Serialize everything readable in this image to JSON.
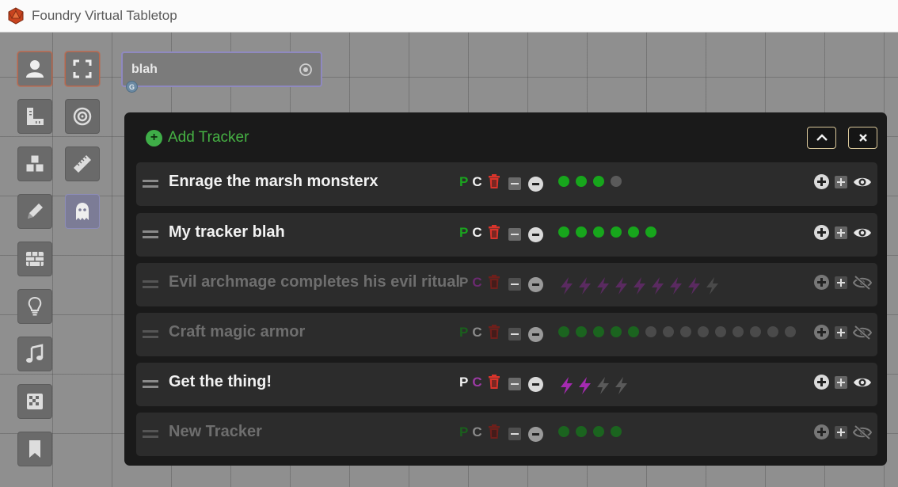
{
  "app": {
    "title": "Foundry Virtual Tabletop"
  },
  "token_field": {
    "value": "blah",
    "badge": "G"
  },
  "controls_left": [
    "user-icon",
    "ruler-square-icon",
    "cubes-icon",
    "pencil-icon",
    "wall-icon",
    "lightbulb-icon",
    "music-icon",
    "dice-icon",
    "bookmark-icon"
  ],
  "controls_right": [
    "expand-icon",
    "target-icon",
    "ruler-icon",
    "ghost-icon"
  ],
  "panel": {
    "add_label": "Add Tracker",
    "collapse_icon": "chevron-up-icon",
    "close_icon": "close-icon"
  },
  "trackers": [
    {
      "name": "Enrage the marsh monsterx",
      "p": "P",
      "c": "C",
      "type": "dots",
      "filled": 3,
      "total": 4,
      "dim": false,
      "visible": true
    },
    {
      "name": "My tracker blah",
      "p": "P",
      "c": "C",
      "type": "dots",
      "filled": 6,
      "total": 6,
      "dim": false,
      "visible": true
    },
    {
      "name": "Evil archmage completes his evil ritual",
      "p": "P",
      "c": "C",
      "type": "bolts",
      "filled": 8,
      "total": 9,
      "dim": true,
      "visible": false
    },
    {
      "name": "Craft magic armor",
      "p": "P",
      "c": "C",
      "type": "dots",
      "filled": 5,
      "total": 14,
      "dim": true,
      "visible": false
    },
    {
      "name": "Get the thing!",
      "p": "P",
      "c": "C",
      "type": "bolts",
      "filled": 2,
      "total": 4,
      "dim": false,
      "visible": true
    },
    {
      "name": "New Tracker",
      "p": "P",
      "c": "C",
      "type": "dots",
      "filled": 4,
      "total": 4,
      "dim": true,
      "visible": false
    }
  ],
  "colors": {
    "p_active": "#1aa31f",
    "p_white": "#f2f2f2",
    "c_white": "#f2f2f2",
    "c_purple": "#9b3aa3",
    "trash": "#d9342b",
    "bolt_on": "#a42ab0",
    "bolt_off": "#5a5a5a",
    "accent_green": "#46b244"
  }
}
